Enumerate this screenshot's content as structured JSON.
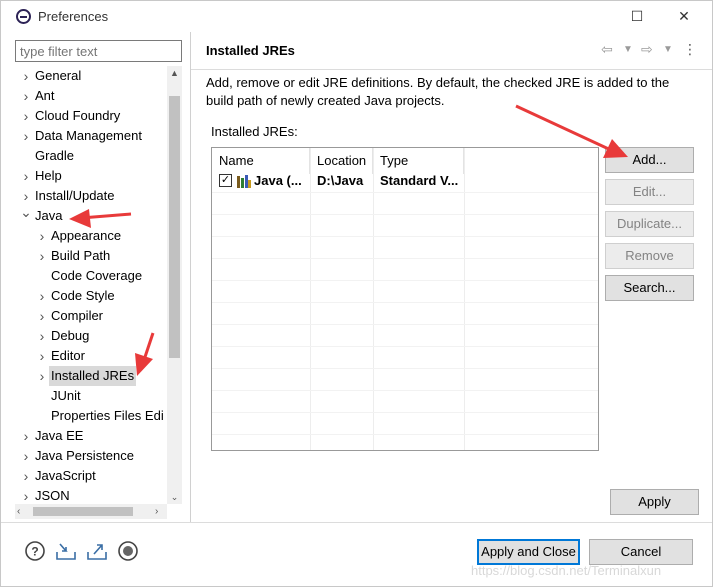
{
  "window": {
    "title": "Preferences",
    "minimize": "—",
    "maximize": "☐",
    "close": "✕"
  },
  "filter": {
    "placeholder": "type filter text"
  },
  "tree": [
    {
      "label": "General",
      "level": 0,
      "chevron": "›"
    },
    {
      "label": "Ant",
      "level": 0,
      "chevron": "›"
    },
    {
      "label": "Cloud Foundry",
      "level": 0,
      "chevron": "›"
    },
    {
      "label": "Data Management",
      "level": 0,
      "chevron": "›"
    },
    {
      "label": "Gradle",
      "level": 0,
      "chevron": ""
    },
    {
      "label": "Help",
      "level": 0,
      "chevron": "›"
    },
    {
      "label": "Install/Update",
      "level": 0,
      "chevron": "›"
    },
    {
      "label": "Java",
      "level": 0,
      "chevron": "⌄"
    },
    {
      "label": "Appearance",
      "level": 1,
      "chevron": "›"
    },
    {
      "label": "Build Path",
      "level": 1,
      "chevron": "›"
    },
    {
      "label": "Code Coverage",
      "level": 1,
      "chevron": ""
    },
    {
      "label": "Code Style",
      "level": 1,
      "chevron": "›"
    },
    {
      "label": "Compiler",
      "level": 1,
      "chevron": "›"
    },
    {
      "label": "Debug",
      "level": 1,
      "chevron": "›"
    },
    {
      "label": "Editor",
      "level": 1,
      "chevron": "›"
    },
    {
      "label": "Installed JREs",
      "level": 1,
      "chevron": "›",
      "selected": true
    },
    {
      "label": "JUnit",
      "level": 1,
      "chevron": ""
    },
    {
      "label": "Properties Files Edi",
      "level": 1,
      "chevron": ""
    },
    {
      "label": "Java EE",
      "level": 0,
      "chevron": "›"
    },
    {
      "label": "Java Persistence",
      "level": 0,
      "chevron": "›"
    },
    {
      "label": "JavaScript",
      "level": 0,
      "chevron": "›"
    },
    {
      "label": "JSON",
      "level": 0,
      "chevron": "›"
    }
  ],
  "page": {
    "title": "Installed JREs",
    "description": "Add, remove or edit JRE definitions. By default, the checked JRE is added to the build path of newly created Java projects.",
    "installed_label": "Installed JREs:"
  },
  "table": {
    "columns": [
      "Name",
      "Location",
      "Type"
    ],
    "rows": [
      {
        "checked": true,
        "name": "Java (...",
        "location": "D:\\Java",
        "type": "Standard V..."
      }
    ]
  },
  "buttons": {
    "add": "Add...",
    "edit": "Edit...",
    "duplicate": "Duplicate...",
    "remove": "Remove",
    "search": "Search...",
    "apply": "Apply",
    "apply_close": "Apply and Close",
    "cancel": "Cancel"
  },
  "watermark": "https://blog.csdn.net/Terminalxun",
  "colors": {
    "annotation_arrow": "#e83a3a",
    "default_button_border": "#0078d7",
    "selection": "#d9d9d9"
  }
}
